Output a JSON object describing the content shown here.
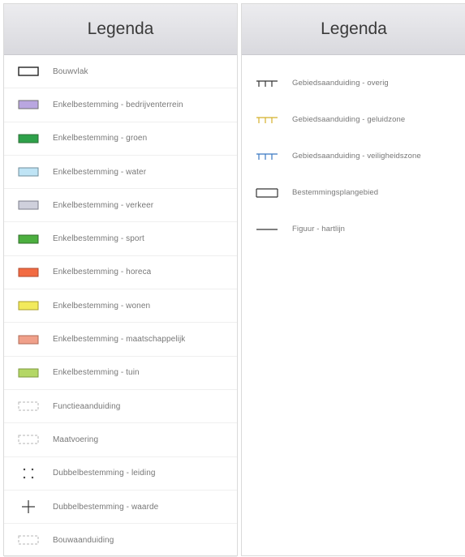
{
  "left_panel": {
    "title": "Legenda",
    "items": [
      {
        "label": "Bouwvlak",
        "symbol": "outline-rect",
        "fill": "#ffffff",
        "stroke": "#222222"
      },
      {
        "label": "Enkelbestemming - bedrijventerrein",
        "symbol": "fill-rect",
        "fill": "#b9a6e0",
        "stroke": "#6f6f6f"
      },
      {
        "label": "Enkelbestemming - groen",
        "symbol": "fill-rect",
        "fill": "#2ea14a",
        "stroke": "#2b6e35"
      },
      {
        "label": "Enkelbestemming - water",
        "symbol": "fill-rect",
        "fill": "#bfe4f5",
        "stroke": "#6f8e9c"
      },
      {
        "label": "Enkelbestemming - verkeer",
        "symbol": "fill-rect",
        "fill": "#cfd0dc",
        "stroke": "#7b7d8a"
      },
      {
        "label": "Enkelbestemming - sport",
        "symbol": "fill-rect",
        "fill": "#4caf3f",
        "stroke": "#2f6e2a"
      },
      {
        "label": "Enkelbestemming - horeca",
        "symbol": "fill-rect",
        "fill": "#f26b43",
        "stroke": "#b0492c"
      },
      {
        "label": "Enkelbestemming - wonen",
        "symbol": "fill-rect",
        "fill": "#f2ea5c",
        "stroke": "#a89e2a"
      },
      {
        "label": "Enkelbestemming - maatschappelijk",
        "symbol": "fill-rect",
        "fill": "#f0a08a",
        "stroke": "#b06a55"
      },
      {
        "label": "Enkelbestemming - tuin",
        "symbol": "fill-rect",
        "fill": "#b4d766",
        "stroke": "#7e9a3e"
      },
      {
        "label": "Functieaanduiding",
        "symbol": "dashed-rect",
        "stroke": "#b5b5b5"
      },
      {
        "label": "Maatvoering",
        "symbol": "dashed-rect",
        "stroke": "#b5b5b5"
      },
      {
        "label": "Dubbelbestemming - leiding",
        "symbol": "dots",
        "stroke": "#444444"
      },
      {
        "label": "Dubbelbestemming - waarde",
        "symbol": "cross",
        "stroke": "#333333"
      },
      {
        "label": "Bouwaanduiding",
        "symbol": "dashed-rect",
        "stroke": "#b5b5b5"
      }
    ]
  },
  "right_panel": {
    "title": "Legenda",
    "items": [
      {
        "label": "Gebiedsaanduiding - overig",
        "symbol": "comb",
        "stroke": "#333333"
      },
      {
        "label": "Gebiedsaanduiding - geluidzone",
        "symbol": "comb",
        "stroke": "#d4b02a"
      },
      {
        "label": "Gebiedsaanduiding - veiligheidszone",
        "symbol": "comb",
        "stroke": "#3a78c2"
      },
      {
        "label": "Bestemmingsplangebied",
        "symbol": "plan-boundary",
        "stroke": "#333333"
      },
      {
        "label": "Figuur - hartlijn",
        "symbol": "line",
        "stroke": "#333333"
      }
    ]
  }
}
